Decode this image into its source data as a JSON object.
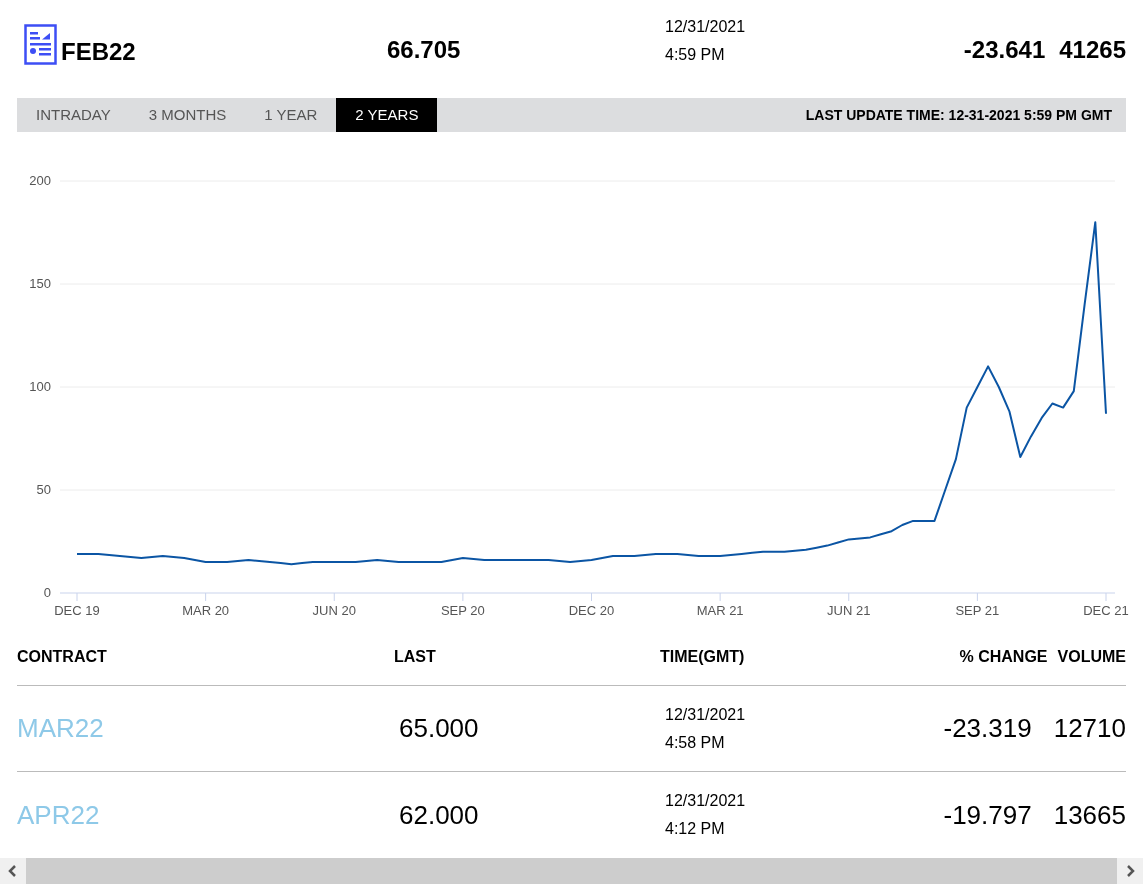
{
  "header": {
    "contract": "FEB22",
    "last": "66.705",
    "date": "12/31/2021",
    "time": "4:59 PM",
    "change": "-23.641",
    "volume": "41265"
  },
  "tabs": [
    {
      "label": "INTRADAY",
      "selected": false
    },
    {
      "label": "3 MONTHS",
      "selected": false
    },
    {
      "label": "1 YEAR",
      "selected": false
    },
    {
      "label": "2 YEARS",
      "selected": true
    }
  ],
  "last_update": "LAST UPDATE TIME: 12-31-2021 5:59 PM GMT",
  "chart": {
    "chart_data": {
      "type": "line",
      "categories": [
        "DEC 19",
        null,
        null,
        null,
        null,
        null,
        null,
        null,
        null,
        null,
        null,
        null,
        "MAR 20",
        null,
        null,
        null,
        null,
        null,
        null,
        null,
        null,
        null,
        null,
        null,
        "JUN 20",
        null,
        null,
        null,
        null,
        null,
        null,
        null,
        null,
        null,
        null,
        null,
        "SEP 20",
        null,
        null,
        null,
        null,
        null,
        null,
        null,
        null,
        null,
        null,
        null,
        "DEC 20",
        null,
        null,
        null,
        null,
        null,
        null,
        null,
        null,
        null,
        null,
        null,
        "MAR 21",
        null,
        null,
        null,
        null,
        null,
        null,
        null,
        null,
        null,
        null,
        null,
        "JUN 21",
        null,
        null,
        null,
        null,
        null,
        null,
        null,
        null,
        null,
        null,
        null,
        "SEP 21",
        null,
        null,
        null,
        null,
        null,
        null,
        null,
        null,
        null,
        null,
        null,
        "DEC 21"
      ],
      "series": [
        {
          "color": "#0b55a4",
          "values": [
            19,
            19,
            19,
            18.5,
            18,
            17.5,
            17,
            17.5,
            18,
            17.5,
            17,
            16,
            15,
            15,
            15,
            15.5,
            16,
            15.5,
            15,
            14.5,
            14,
            14.5,
            15,
            15,
            15,
            15,
            15,
            15.5,
            16,
            15.5,
            15,
            15,
            15,
            15,
            15,
            16,
            17,
            16.5,
            16,
            16,
            16,
            16,
            16,
            16,
            16,
            15.5,
            15,
            15.5,
            16,
            17,
            18,
            18,
            18,
            18.5,
            19,
            19,
            19,
            18.5,
            18,
            18,
            18,
            18.5,
            19,
            19.5,
            20,
            20,
            20,
            20.5,
            21,
            22,
            23,
            24.5,
            26,
            26.5,
            27,
            28.5,
            30,
            33,
            35,
            35,
            35,
            50,
            65,
            90,
            100,
            110,
            100,
            88,
            66,
            76,
            85,
            92,
            90,
            98,
            140,
            180,
            87
          ]
        }
      ],
      "grid": true,
      "ylim": [
        0,
        200
      ],
      "yticks": [
        0,
        50,
        100,
        150,
        200
      ]
    }
  },
  "table": {
    "columns": [
      "CONTRACT",
      "LAST",
      "TIME(GMT)",
      "% CHANGE",
      "VOLUME"
    ],
    "rows": [
      {
        "contract": "MAR22",
        "last": "65.000",
        "date": "12/31/2021",
        "time": "4:58 PM",
        "change": "-23.319",
        "volume": "12710"
      },
      {
        "contract": "APR22",
        "last": "62.000",
        "date": "12/31/2021",
        "time": "4:12 PM",
        "change": "-19.797",
        "volume": "13665"
      }
    ]
  }
}
